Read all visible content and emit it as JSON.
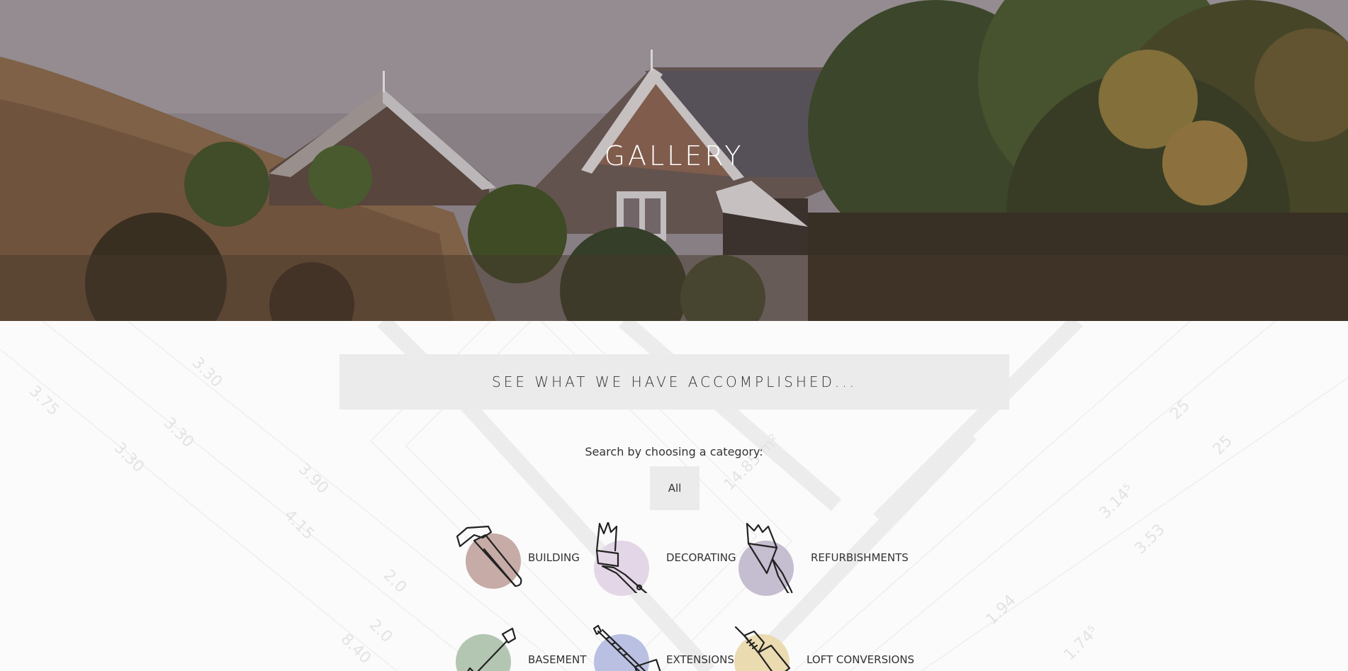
{
  "hero": {
    "title": "GALLERY"
  },
  "banner": {
    "text": "SEE WHAT WE HAVE ACCOMPLISHED..."
  },
  "filter": {
    "label": "Search by choosing a category:",
    "all_label": "All"
  },
  "categories": [
    {
      "label": "BUILDING",
      "icon": "hammer-icon",
      "color": "#c6aba6"
    },
    {
      "label": "DECORATING",
      "icon": "paintbrush-icon",
      "color": "#e3d6e6"
    },
    {
      "label": "REFURBISHMENTS",
      "icon": "trowel-icon",
      "color": "#c5bdd0"
    },
    {
      "label": "BASEMENT",
      "icon": "shovel-icon",
      "color": "#b3c6b2"
    },
    {
      "label": "EXTENSIONS",
      "icon": "measuring-tape-icon",
      "color": "#b9c0e1"
    },
    {
      "label": "LOFT CONVERSIONS",
      "icon": "drill-icon",
      "color": "#eadbb0"
    }
  ]
}
